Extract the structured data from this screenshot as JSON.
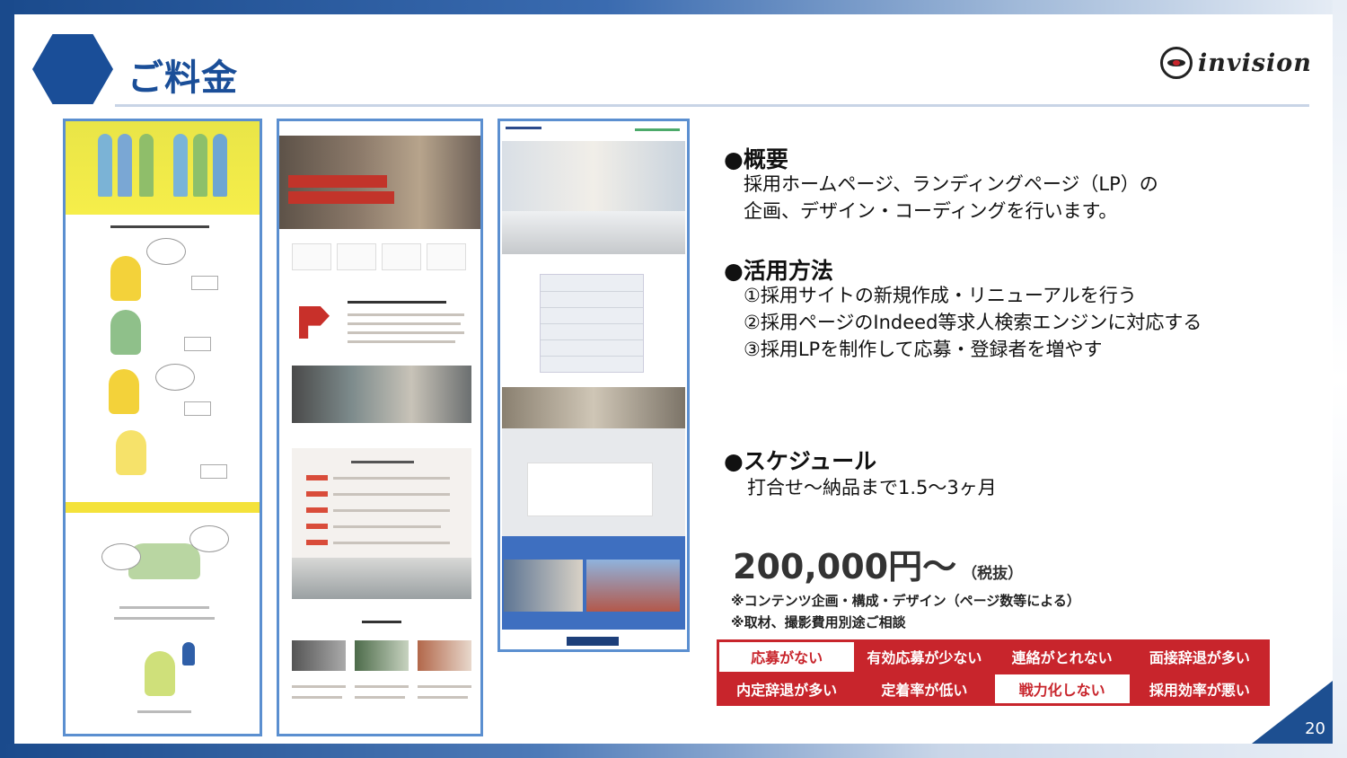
{
  "title": "ご料金",
  "logo": {
    "text": "invision"
  },
  "page_number": "20",
  "overview": {
    "heading": "●概要",
    "lines": [
      "採用ホームページ、ランディングページ（LP）の",
      "企画、デザイン・コーディングを行います。"
    ]
  },
  "usage": {
    "heading": "●活用方法",
    "lines": [
      "①採用サイトの新規作成・リニューアルを行う",
      "②採用ページのIndeed等求人検索エンジンに対応する",
      "③採用LPを制作して応募・登録者を増やす"
    ]
  },
  "schedule": {
    "heading": "●スケジュール",
    "line": "打合せ～納品まで1.5～3ヶ月"
  },
  "price": {
    "amount": "200,000円～",
    "tax": "（税抜）"
  },
  "notes": [
    "※コンテンツ企画・構成・デザイン（ページ数等による）",
    "※取材、撮影費用別途ご相談"
  ],
  "tags": [
    {
      "label": "応募がない",
      "highlight": true
    },
    {
      "label": "有効応募が少ない",
      "highlight": false
    },
    {
      "label": "連絡がとれない",
      "highlight": false
    },
    {
      "label": "面接辞退が多い",
      "highlight": false
    },
    {
      "label": "内定辞退が多い",
      "highlight": false
    },
    {
      "label": "定着率が低い",
      "highlight": false
    },
    {
      "label": "戦力化しない",
      "highlight": true
    },
    {
      "label": "採用効率が悪い",
      "highlight": false
    }
  ],
  "colors": {
    "brand_blue": "#1a4e98",
    "accent_red": "#c8252c",
    "thumb_border": "#5b8fd0"
  },
  "thumbnails": [
    {
      "name": "landing-page-sample-1"
    },
    {
      "name": "recruit-site-sample-2"
    },
    {
      "name": "recruit-site-sample-3"
    }
  ]
}
